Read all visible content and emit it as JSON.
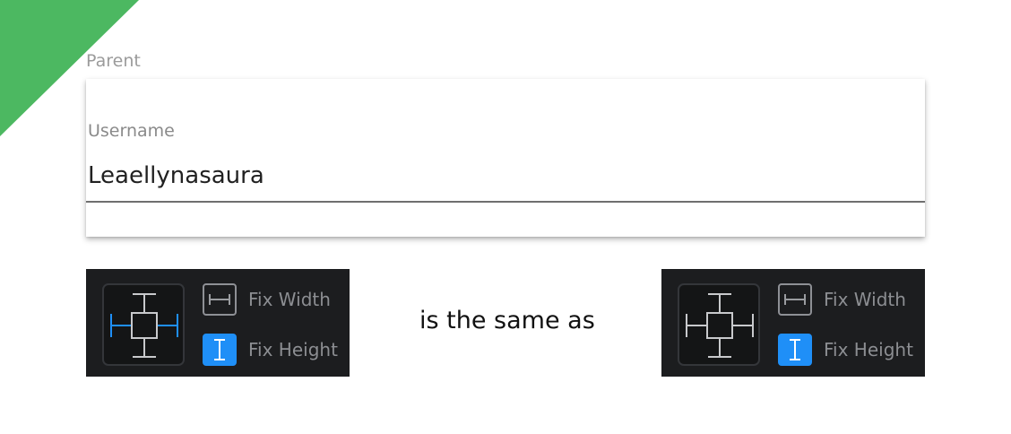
{
  "parent": {
    "label": "Parent"
  },
  "username_field": {
    "label": "Username",
    "value": "Leaellynasaura"
  },
  "comparison_text": "is the same as",
  "panels": [
    {
      "fix_width_label": "Fix Width",
      "fix_height_label": "Fix Height",
      "fix_width_active": false,
      "fix_height_active": true,
      "horizontal_pins_active": true
    },
    {
      "fix_width_label": "Fix Width",
      "fix_height_label": "Fix Height",
      "fix_width_active": false,
      "fix_height_active": true,
      "horizontal_pins_active": false
    }
  ],
  "colors": {
    "ribbon": "#4cb861",
    "accent_blue": "#1f8ff7",
    "panel_bg": "#1c1d1f",
    "inactive_gray": "#8e9095"
  }
}
